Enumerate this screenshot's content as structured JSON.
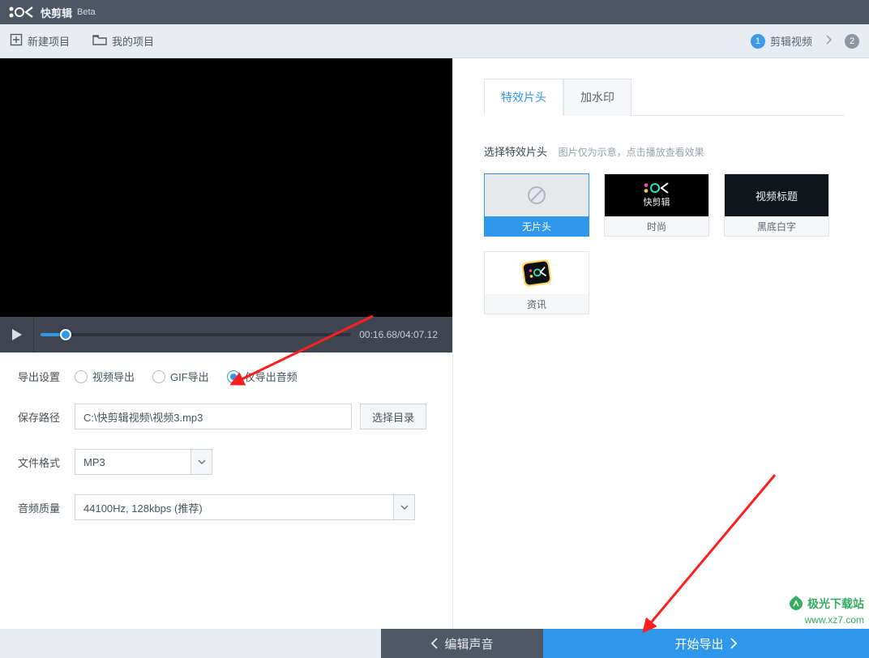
{
  "titlebar": {
    "app_name": "快剪辑",
    "beta": "Beta"
  },
  "toolbar": {
    "new_project": "新建项目",
    "my_projects": "我的项目",
    "step_label": "剪辑视频",
    "step_num": "1",
    "step_num2": "2"
  },
  "player": {
    "time": "00:16.68/04:07.12"
  },
  "export": {
    "title": "导出设置",
    "options": {
      "video": "视频导出",
      "gif": "GIF导出",
      "audio": "仅导出音频"
    },
    "path_label": "保存路径",
    "path_value": "C:\\快剪辑视频\\视频3.mp3",
    "browse": "选择目录",
    "format_label": "文件格式",
    "format_value": "MP3",
    "quality_label": "音频质量",
    "quality_value": "44100Hz, 128kbps (推荐)"
  },
  "right": {
    "tabs": {
      "effects": "特效片头",
      "watermark": "加水印"
    },
    "section": "选择特效片头",
    "hint": "图片仅为示意，点击播放查看效果",
    "cards": {
      "none": "无片头",
      "fashion": "时尚",
      "black_bg": "黑底白字",
      "news": "资讯",
      "title_text": "视频标题",
      "logo_text": "快剪辑"
    }
  },
  "footer": {
    "back": "编辑声音",
    "export": "开始导出"
  },
  "watermark": {
    "line1": "极光下载站",
    "line2": "www.xz7.com"
  }
}
